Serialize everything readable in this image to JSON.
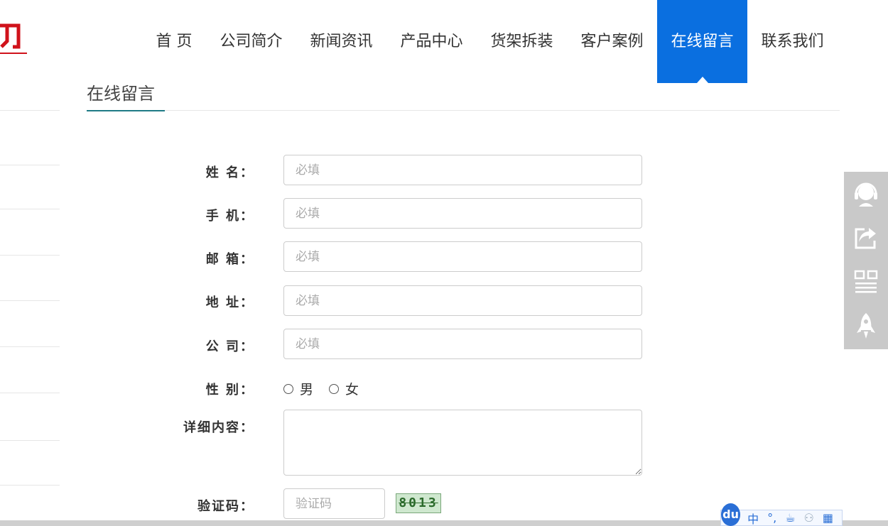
{
  "nav": {
    "items": [
      {
        "label": "首 页"
      },
      {
        "label": "公司简介"
      },
      {
        "label": "新闻资讯"
      },
      {
        "label": "产品中心"
      },
      {
        "label": "货架拆装"
      },
      {
        "label": "客户案例"
      },
      {
        "label": "在线留言"
      },
      {
        "label": "联系我们"
      }
    ],
    "active_index": 6
  },
  "section": {
    "title": "在线留言"
  },
  "form": {
    "name": {
      "label": "姓 名：",
      "placeholder": "必填"
    },
    "phone": {
      "label": "手 机：",
      "placeholder": "必填"
    },
    "email": {
      "label": "邮 箱：",
      "placeholder": "必填"
    },
    "address": {
      "label": "地 址：",
      "placeholder": "必填"
    },
    "company": {
      "label": "公 司：",
      "placeholder": "必填"
    },
    "gender": {
      "label": "性 别：",
      "options": [
        "男",
        "女"
      ]
    },
    "detail": {
      "label": "详细内容："
    },
    "captcha": {
      "label": "验证码：",
      "placeholder": "验证码",
      "image_text": "8013"
    }
  },
  "ime": {
    "logo": "du",
    "mode": "中",
    "punct": "°,"
  },
  "colors": {
    "accent": "#0a6fe0",
    "logo_red": "#d0121b",
    "title_underline": "#1e7a85"
  }
}
